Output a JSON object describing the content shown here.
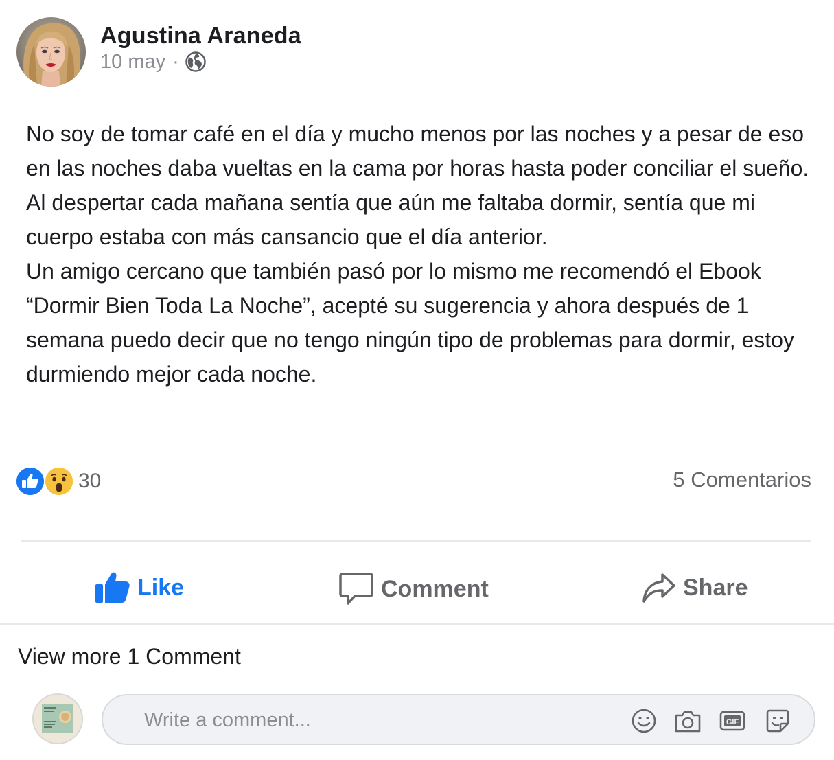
{
  "post": {
    "author": "Agustina Araneda",
    "date": "10 may",
    "separator": "·",
    "audience_icon": "globe-icon",
    "paragraphs": [
      "No soy de tomar café en el día y mucho menos por las noches y a pesar de eso en las noches daba vueltas en la cama por horas hasta poder conciliar el sueño. Al despertar cada mañana sentía que aún me faltaba dormir, sentía que mi cuerpo estaba con más cansancio que el día anterior.",
      "Un amigo cercano que también pasó por lo mismo me recomendó el Ebook “Dormir Bien Toda La Noche”, acepté su sugerencia y ahora después de 1 semana puedo decir que no tengo ningún tipo de problemas para dormir, estoy durmiendo mejor cada noche."
    ]
  },
  "reactions": {
    "icons": [
      "like-reaction-icon",
      "wow-reaction-icon"
    ],
    "count": "30",
    "comments_label": "5 Comentarios"
  },
  "actions": {
    "like": "Like",
    "comment": "Comment",
    "share": "Share"
  },
  "view_more": "View more 1 Comment",
  "composer": {
    "placeholder": "Write a comment...",
    "icons": [
      "emoji-icon",
      "camera-icon",
      "gif-icon",
      "sticker-icon"
    ]
  },
  "colors": {
    "like_blue": "#1877f2",
    "muted_text": "#65676b",
    "wow_yellow": "#f7c33e"
  }
}
